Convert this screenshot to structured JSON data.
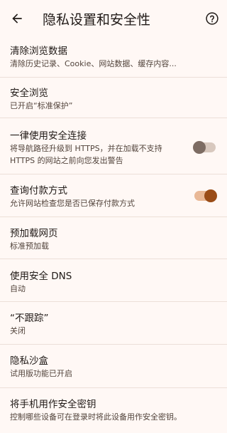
{
  "header": {
    "title": "隐私设置和安全性",
    "back_icon": "back-arrow-icon",
    "help_icon": "help-icon"
  },
  "colors": {
    "surface": "#fff8f5",
    "divider": "#e9dfd9",
    "toggle_on": "#9a4c17",
    "toggle_off": "#7d6c63"
  },
  "items": [
    {
      "title": "清除浏览数据",
      "subtitle": "清除历史记录、Cookie、网站数据、缓存内容..."
    },
    {
      "title": "安全浏览",
      "subtitle": "已开启“标准保护”"
    },
    {
      "title": "一律使用安全连接",
      "subtitle_lines": [
        "将导航路径升级到 HTTPS，并在加载不支持",
        "HTTPS 的网站之前向您发出警告"
      ],
      "toggle": false
    },
    {
      "title": "查询付款方式",
      "subtitle": "允许网站检查您是否已保存付款方式",
      "toggle": true
    },
    {
      "title": "预加载网页",
      "subtitle": "标准预加载"
    },
    {
      "title": "使用安全 DNS",
      "subtitle": "自动"
    },
    {
      "title": "“不跟踪”",
      "subtitle": "关闭"
    },
    {
      "title": "隐私沙盒",
      "subtitle": "试用版功能已开启"
    },
    {
      "title": "将手机用作安全密钥",
      "subtitle": "控制哪些设备可在登录时将此设备用作安全密钥。"
    }
  ]
}
